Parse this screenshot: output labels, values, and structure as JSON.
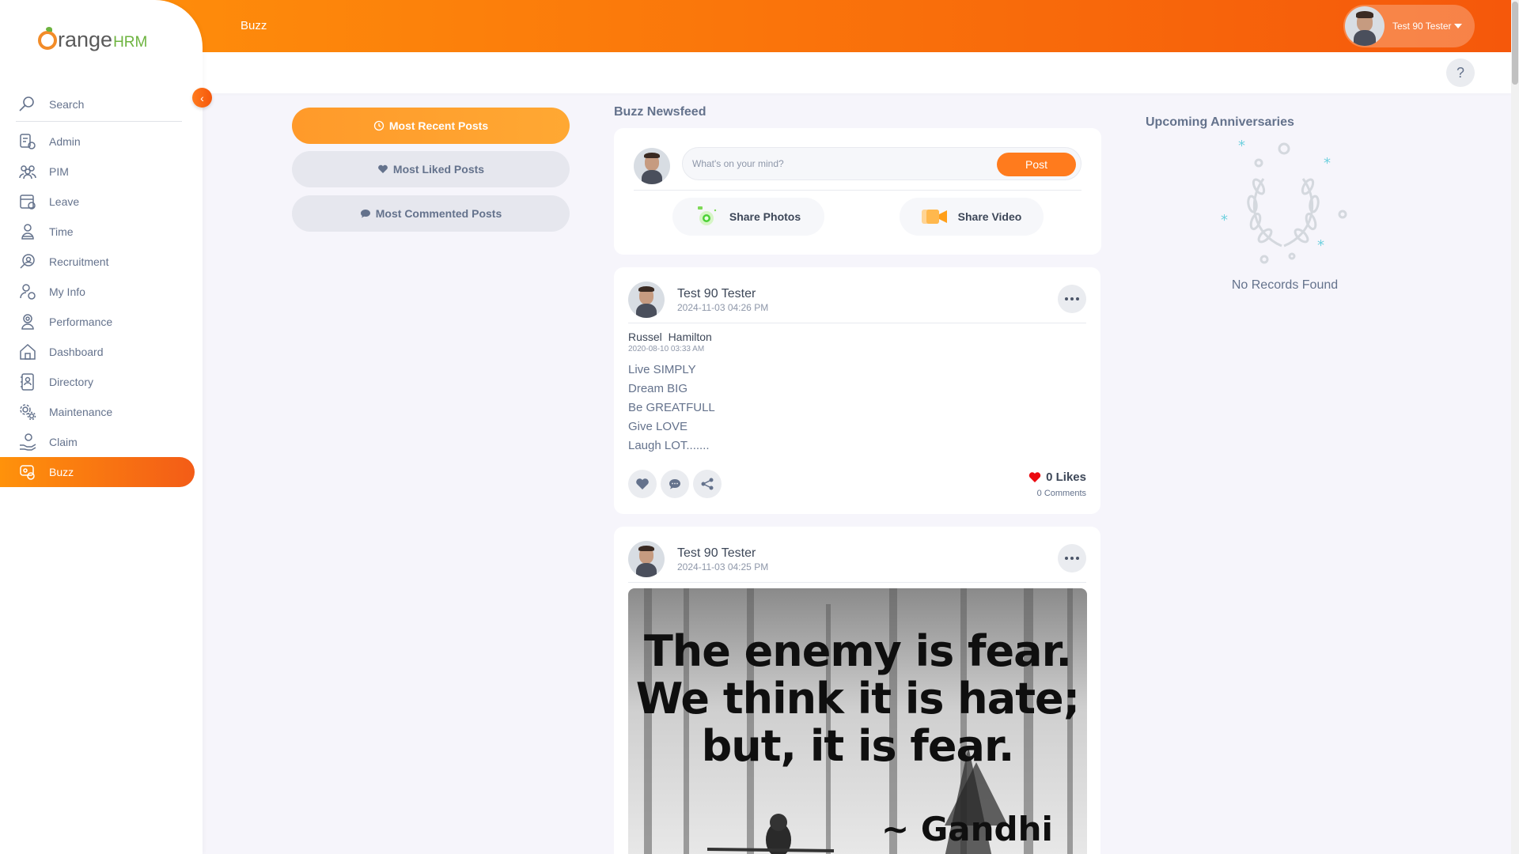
{
  "brand": {
    "name_part1": "range",
    "name_part2": "HRM"
  },
  "header": {
    "title": "Buzz",
    "user_name": "Test 90 Tester",
    "help_label": "?"
  },
  "sidebar": {
    "search_placeholder": "Search",
    "items": [
      {
        "label": "Admin",
        "icon": "admin-icon"
      },
      {
        "label": "PIM",
        "icon": "pim-icon"
      },
      {
        "label": "Leave",
        "icon": "leave-icon"
      },
      {
        "label": "Time",
        "icon": "time-icon"
      },
      {
        "label": "Recruitment",
        "icon": "recruitment-icon"
      },
      {
        "label": "My Info",
        "icon": "my-info-icon"
      },
      {
        "label": "Performance",
        "icon": "performance-icon"
      },
      {
        "label": "Dashboard",
        "icon": "dashboard-icon"
      },
      {
        "label": "Directory",
        "icon": "directory-icon"
      },
      {
        "label": "Maintenance",
        "icon": "maintenance-icon"
      },
      {
        "label": "Claim",
        "icon": "claim-icon"
      },
      {
        "label": "Buzz",
        "icon": "buzz-icon",
        "active": true
      }
    ]
  },
  "filters": {
    "recent": "Most Recent Posts",
    "liked": "Most Liked Posts",
    "commented": "Most Commented Posts"
  },
  "feed": {
    "title": "Buzz Newsfeed",
    "composer": {
      "placeholder": "What's on your mind?",
      "post_label": "Post",
      "share_photos": "Share Photos",
      "share_video": "Share Video"
    },
    "posts": [
      {
        "author": "Test 90 Tester",
        "date": "2024-11-03 04:26 PM",
        "shared_author": "Russel  Hamilton",
        "shared_date": "2020-08-10 03:33 AM",
        "lines": [
          "Live SIMPLY",
          "Dream BIG",
          "Be GREATFULL",
          "Give LOVE",
          "Laugh LOT......."
        ],
        "likes": "0 Likes",
        "comments": "0 Comments"
      },
      {
        "author": "Test 90 Tester",
        "date": "2024-11-03 04:25 PM",
        "image_quote": [
          "The enemy is fear.",
          "We think it is hate;",
          "but, it is fear."
        ],
        "image_attribution": "~ Gandhi"
      }
    ]
  },
  "anniversaries": {
    "title": "Upcoming Anniversaries",
    "empty": "No Records Found"
  },
  "colors": {
    "accent": "#ff7b1d",
    "accent_dark": "#f5570c",
    "text": "#64728c",
    "like": "#eb0910"
  }
}
